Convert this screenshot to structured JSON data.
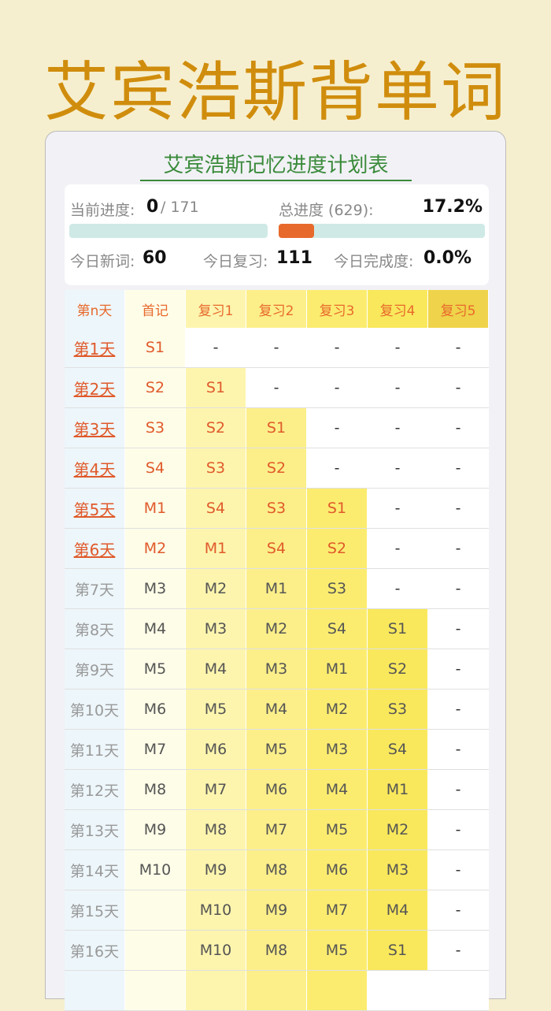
{
  "hero_title": "艾宾浩斯背单词",
  "card_title": "艾宾浩斯记忆进度计划表",
  "stats": {
    "current_label": "当前进度:",
    "current_value": "0",
    "current_total": "/ 171",
    "current_progress": 0,
    "total_label": "总进度 (629):",
    "total_value": "17.2%",
    "total_progress": 0.172,
    "new_label": "今日新词:",
    "new_value": "60",
    "review_label": "今日复习:",
    "review_value": "111",
    "done_label": "今日完成度:",
    "done_value": "0.0%"
  },
  "colors": {
    "accent": "#e8692c",
    "title_green": "#3a8a3a",
    "hero": "#d08d0d"
  },
  "headers": [
    "第n天",
    "首记",
    "复习1",
    "复习2",
    "复习3",
    "复习4",
    "复习5"
  ],
  "rows": [
    {
      "day": "第1天",
      "hl": true,
      "cells": [
        "S1",
        "-",
        "-",
        "-",
        "-",
        "-"
      ]
    },
    {
      "day": "第2天",
      "hl": true,
      "cells": [
        "S2",
        "S1",
        "-",
        "-",
        "-",
        "-"
      ]
    },
    {
      "day": "第3天",
      "hl": true,
      "cells": [
        "S3",
        "S2",
        "S1",
        "-",
        "-",
        "-"
      ]
    },
    {
      "day": "第4天",
      "hl": true,
      "cells": [
        "S4",
        "S3",
        "S2",
        "-",
        "-",
        "-"
      ]
    },
    {
      "day": "第5天",
      "hl": true,
      "cells": [
        "M1",
        "S4",
        "S3",
        "S1",
        "-",
        "-"
      ]
    },
    {
      "day": "第6天",
      "hl": true,
      "cells": [
        "M2",
        "M1",
        "S4",
        "S2",
        "-",
        "-"
      ]
    },
    {
      "day": "第7天",
      "hl": false,
      "cells": [
        "M3",
        "M2",
        "M1",
        "S3",
        "-",
        "-"
      ]
    },
    {
      "day": "第8天",
      "hl": false,
      "cells": [
        "M4",
        "M3",
        "M2",
        "S4",
        "S1",
        "-"
      ]
    },
    {
      "day": "第9天",
      "hl": false,
      "cells": [
        "M5",
        "M4",
        "M3",
        "M1",
        "S2",
        "-"
      ]
    },
    {
      "day": "第10天",
      "hl": false,
      "cells": [
        "M6",
        "M5",
        "M4",
        "M2",
        "S3",
        "-"
      ]
    },
    {
      "day": "第11天",
      "hl": false,
      "cells": [
        "M7",
        "M6",
        "M5",
        "M3",
        "S4",
        "-"
      ]
    },
    {
      "day": "第12天",
      "hl": false,
      "cells": [
        "M8",
        "M7",
        "M6",
        "M4",
        "M1",
        "-"
      ]
    },
    {
      "day": "第13天",
      "hl": false,
      "cells": [
        "M9",
        "M8",
        "M7",
        "M5",
        "M2",
        "-"
      ]
    },
    {
      "day": "第14天",
      "hl": false,
      "cells": [
        "M10",
        "M9",
        "M8",
        "M6",
        "M3",
        "-"
      ]
    },
    {
      "day": "第15天",
      "hl": false,
      "cells": [
        "",
        "M10",
        "M9",
        "M7",
        "M4",
        "-"
      ]
    },
    {
      "day": "第16天",
      "hl": false,
      "cells": [
        "",
        "M10",
        "M8",
        "M5",
        "S1",
        "-"
      ]
    },
    {
      "day": "",
      "hl": false,
      "cells": [
        "",
        "",
        "",
        "",
        null,
        null
      ]
    }
  ]
}
